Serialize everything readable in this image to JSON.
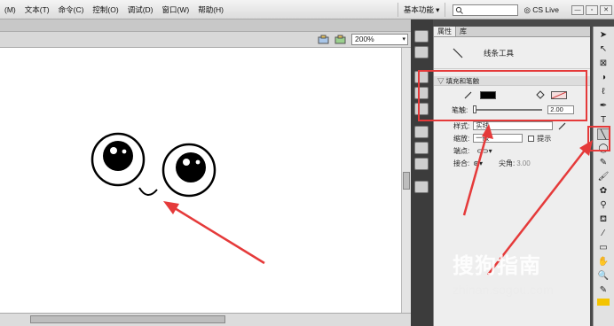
{
  "menu": {
    "items": [
      "(M)",
      "文本(T)",
      "命令(C)",
      "控制(O)",
      "调试(D)",
      "窗口(W)",
      "帮助(H)"
    ]
  },
  "workspace": {
    "label": "基本功能 ▾"
  },
  "search": {
    "value": ""
  },
  "cslive": {
    "label": "CS Live"
  },
  "window_controls": {
    "minimize": "—",
    "restore": "▫",
    "close": "✕"
  },
  "stage": {
    "zoom": "200%"
  },
  "properties": {
    "tabs": [
      "属性",
      "库"
    ],
    "tool_name": "线条工具",
    "section_fill_stroke": "填充和笔触",
    "stroke_label": "笔触:",
    "stroke_value": "2.00",
    "style_label": "样式:",
    "style_value": "实线",
    "scale_label": "缩放:",
    "scale_value": "一般",
    "hint_label": "提示",
    "cap_label": "端点:",
    "join_label": "接合:",
    "miter_label": "尖角:",
    "miter_value": "3.00"
  },
  "colors": {
    "stroke_color": "#000000",
    "fill_none": "#ffffff",
    "annotation_red": "#e53a3a"
  },
  "watermark": {
    "title": "搜狗指南",
    "url": "zhinan.sogou.com"
  }
}
